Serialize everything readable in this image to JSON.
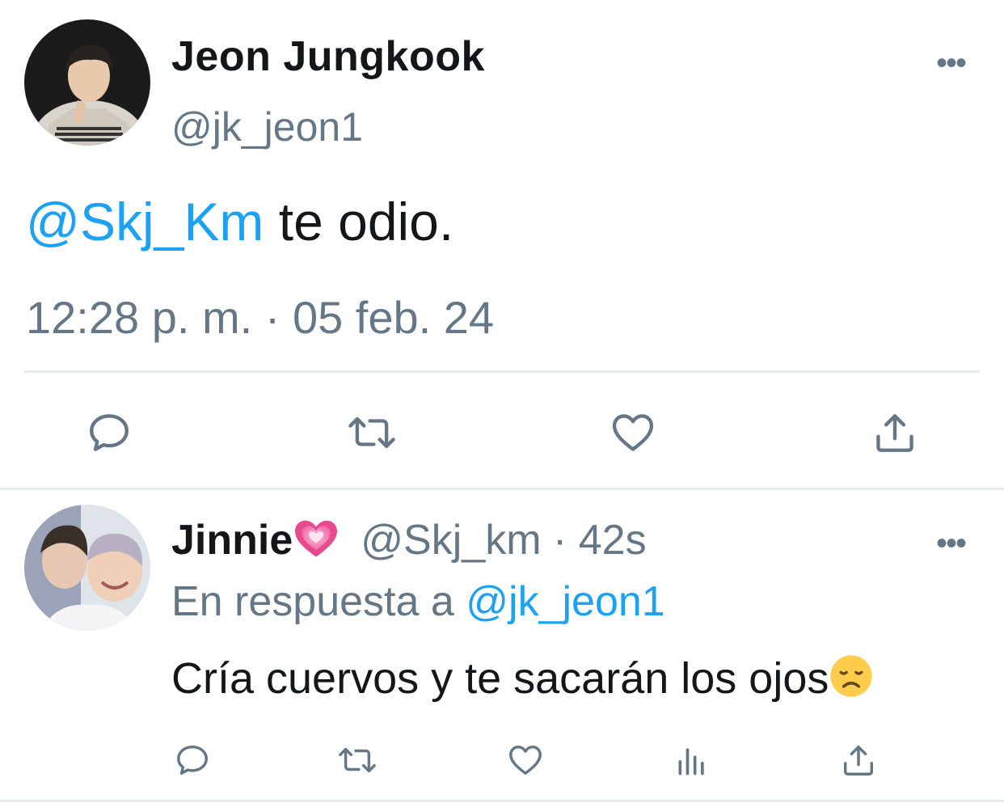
{
  "tweet": {
    "author_name": "Jeon Jungkook",
    "author_handle": "@jk_jeon1",
    "mention": "@Skj_Km",
    "text": " te odio.",
    "time": "12:28 p. m.",
    "separator": " · ",
    "date": "05 feb. 24",
    "more_label": "•••",
    "actions": [
      "reply-icon",
      "retweet-icon",
      "like-icon",
      "share-icon"
    ]
  },
  "reply": {
    "author_name": "Jinnie",
    "name_emoji": "growing-heart-emoji",
    "author_handle": "@Skj_km",
    "separator": " · ",
    "age": "42s",
    "in_reply_prefix": "En respuesta a ",
    "in_reply_handle": "@jk_jeon1",
    "text": "Cría cuervos y te sacarán los ojos",
    "text_emoji": "disappointed-face-emoji",
    "more_label": "•••",
    "actions": [
      "reply-icon",
      "retweet-icon",
      "like-icon",
      "analytics-icon",
      "share-icon"
    ]
  },
  "colors": {
    "link": "#1da1f2",
    "secondary": "#657786",
    "primary": "#14171a",
    "divider": "#e6ecf0"
  }
}
